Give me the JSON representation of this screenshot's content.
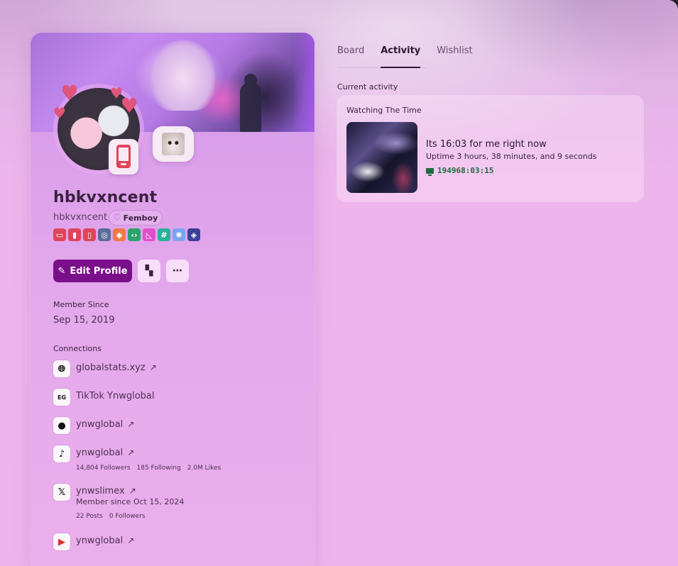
{
  "profile": {
    "display_name": "hbkvxncent",
    "username": "hbkvxncent",
    "tag_icon": "heart-outline-icon",
    "tag_label": "Femboy",
    "badges": [
      {
        "name": "monitor-badge-icon",
        "glyph": "▭",
        "color": "#e0445a"
      },
      {
        "name": "bars-badge-icon",
        "glyph": "▮",
        "color": "#e0445a"
      },
      {
        "name": "phone-badge-icon",
        "glyph": "▯",
        "color": "#e0445a"
      },
      {
        "name": "nitro-badge-icon",
        "glyph": "◎",
        "color": "#5b6b9a"
      },
      {
        "name": "hypesquad-badge-icon",
        "glyph": "◆",
        "color": "#f07a4a"
      },
      {
        "name": "developer-badge-icon",
        "glyph": "‹›",
        "color": "#2aa36a"
      },
      {
        "name": "triangle-badge-icon",
        "glyph": "◺",
        "color": "#e050c8"
      },
      {
        "name": "hashtag-badge-icon",
        "glyph": "#",
        "color": "#2ab09a"
      },
      {
        "name": "gear-badge-icon",
        "glyph": "✺",
        "color": "#7aa4f0"
      },
      {
        "name": "quest-badge-icon",
        "glyph": "◈",
        "color": "#3b3f9a"
      }
    ],
    "edit_label": "Edit Profile",
    "member_since_title": "Member Since",
    "member_since": "Sep 15, 2019",
    "connections_title": "Connections"
  },
  "connections": [
    {
      "icon": "globe-icon",
      "name": "globalstats.xyz",
      "arrow": "↗"
    },
    {
      "icon": "epic-games-icon",
      "name": "TikTok Ynwglobal",
      "arrow": ""
    },
    {
      "icon": "github-icon",
      "name": "ynwglobal",
      "arrow": "↗"
    },
    {
      "icon": "tiktok-icon",
      "name": "ynwglobal",
      "arrow": "↗",
      "stats": [
        "14,804 Followers",
        "185 Following",
        "2.0M Likes"
      ]
    },
    {
      "icon": "x-icon",
      "name": "ynwslimex",
      "arrow": "↗",
      "member_since": "Member since Oct 15, 2024",
      "stats": [
        "22 Posts",
        "0 Followers"
      ]
    },
    {
      "icon": "youtube-icon",
      "name": "ynwglobal",
      "arrow": "↗"
    }
  ],
  "tabs": [
    {
      "label": "Board",
      "active": false
    },
    {
      "label": "Activity",
      "active": true
    },
    {
      "label": "Wishlist",
      "active": false
    }
  ],
  "activity": {
    "section_label": "Current activity",
    "title": "Watching The Time",
    "details": "Its 16:03 for me right now",
    "state": "Uptime 3 hours, 38 minutes, and 9 seconds",
    "elapsed": "194968:03:15"
  },
  "colors": {
    "accent_button": "#7b0e8a",
    "elapsed_green": "#1d6a3c"
  }
}
